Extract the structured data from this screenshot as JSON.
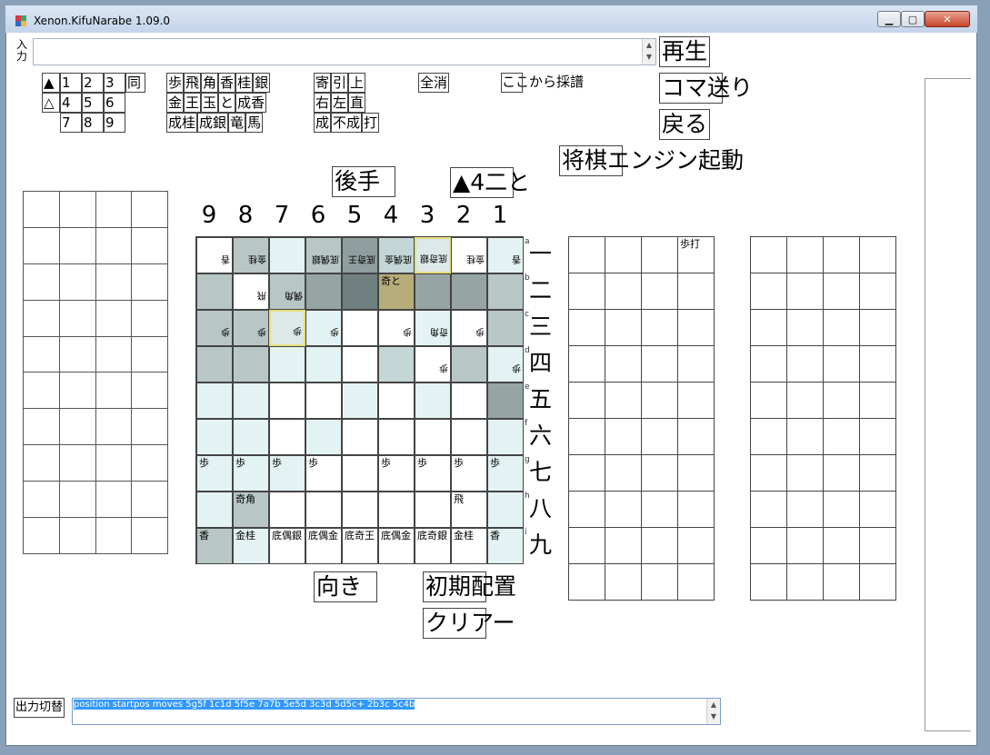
{
  "window": {
    "title": "Xenon.KifuNarabe 1.09.0",
    "minimize_label": "0",
    "maximize_label": "1",
    "close_label": "r"
  },
  "input": {
    "label": "入力",
    "value": ""
  },
  "buttons": {
    "play": "再生",
    "step": "コマ送り",
    "back": "戻る",
    "engine": "将棋エンジン起動",
    "gote": "後手",
    "last_move": "▲4二と",
    "direction": "向き",
    "initial": "初期配置",
    "clear": "クリアー",
    "output_toggle": "出力切替"
  },
  "palette": {
    "turn": [
      [
        "▲",
        "1",
        "2",
        "3",
        "同"
      ],
      [
        "△",
        "4",
        "5",
        "6"
      ],
      [
        "7",
        "8",
        "9"
      ]
    ],
    "pieces": [
      [
        "歩",
        "飛",
        "角",
        "香",
        "桂",
        "銀"
      ],
      [
        "金",
        "王",
        "玉",
        "と",
        "成香"
      ],
      [
        "成桂",
        "成銀",
        "竜",
        "馬"
      ]
    ],
    "modifiers": [
      [
        "寄",
        "引",
        "上"
      ],
      [
        "右",
        "左",
        "直"
      ],
      [
        "成",
        "不成",
        "打"
      ]
    ],
    "clear_all": "全消",
    "record_from_here": "ここから採譜"
  },
  "board": {
    "columns": [
      "9",
      "8",
      "7",
      "6",
      "5",
      "4",
      "3",
      "2",
      "1"
    ],
    "rows": [
      "一",
      "二",
      "三",
      "四",
      "五",
      "六",
      "七",
      "八",
      "九"
    ],
    "row_letters": [
      "a",
      "b",
      "c",
      "d",
      "e",
      "f",
      "g",
      "h",
      "i"
    ],
    "squares": [
      [
        {
          "t": "香",
          "rev": true,
          "bg": "#ffffff"
        },
        {
          "t": "金桂",
          "rev": true,
          "bg": "#b9c6c6"
        },
        {
          "t": "",
          "bg": "#e3f2f2",
          "hl": false
        },
        {
          "t": "底偶銀",
          "rev": true,
          "bg": "#b9c6c6"
        },
        {
          "t": "底奇王",
          "rev": true,
          "bg": "#8f9e9e"
        },
        {
          "t": "底偶金",
          "rev": true,
          "bg": "#c4d6d6"
        },
        {
          "t": "底奇銀",
          "rev": true,
          "bg": "#dde8e8",
          "hl": true
        },
        {
          "t": "金桂",
          "rev": true,
          "bg": "#ffffff"
        },
        {
          "t": "香",
          "rev": true,
          "bg": "#e3f2f2"
        }
      ],
      [
        {
          "t": "",
          "bg": "#b9c6c6"
        },
        {
          "t": "飛",
          "rev": true,
          "bg": "#ffffff"
        },
        {
          "t": "偶角",
          "rev": true,
          "bg": "#b9c6c6"
        },
        {
          "t": "",
          "bg": "#96a4a4"
        },
        {
          "t": "",
          "bg": "#6f7f7f"
        },
        {
          "t": "奇と",
          "bg": "#b7ad7a"
        },
        {
          "t": "",
          "bg": "#96a4a4"
        },
        {
          "t": "",
          "bg": "#96a4a4"
        },
        {
          "t": "",
          "bg": "#b9c6c6"
        }
      ],
      [
        {
          "t": "歩",
          "rev": true,
          "bg": "#b9c6c6"
        },
        {
          "t": "歩",
          "rev": true,
          "bg": "#b9c6c6"
        },
        {
          "t": "歩",
          "rev": true,
          "bg": "#dde8e8",
          "hl": true
        },
        {
          "t": "歩",
          "rev": true,
          "bg": "#e3f2f2"
        },
        {
          "t": "",
          "bg": "#ffffff"
        },
        {
          "t": "歩",
          "rev": true,
          "bg": "#ffffff"
        },
        {
          "t": "奇角",
          "rev": true,
          "bg": "#e3f2f2"
        },
        {
          "t": "歩",
          "rev": true,
          "bg": "#ffffff"
        },
        {
          "t": "",
          "bg": "#b9c6c6"
        }
      ],
      [
        {
          "t": "",
          "bg": "#b9c6c6"
        },
        {
          "t": "",
          "bg": "#b9c6c6"
        },
        {
          "t": "",
          "bg": "#e3f2f2"
        },
        {
          "t": "",
          "bg": "#e3f2f2"
        },
        {
          "t": "",
          "bg": "#ffffff"
        },
        {
          "t": "",
          "bg": "#c4d6d6"
        },
        {
          "t": "歩",
          "rev": true,
          "bg": "#ffffff"
        },
        {
          "t": "",
          "bg": "#b9c6c6"
        },
        {
          "t": "歩",
          "rev": true,
          "bg": "#e3f2f2"
        }
      ],
      [
        {
          "t": "",
          "bg": "#e3f2f2"
        },
        {
          "t": "",
          "bg": "#e3f2f2"
        },
        {
          "t": "",
          "bg": "#ffffff"
        },
        {
          "t": "",
          "bg": "#ffffff"
        },
        {
          "t": "",
          "bg": "#e3f2f2"
        },
        {
          "t": "",
          "bg": "#ffffff"
        },
        {
          "t": "",
          "bg": "#e3f2f2"
        },
        {
          "t": "",
          "bg": "#ffffff"
        },
        {
          "t": "",
          "bg": "#96a4a4"
        }
      ],
      [
        {
          "t": "",
          "bg": "#e3f2f2"
        },
        {
          "t": "",
          "bg": "#e3f2f2"
        },
        {
          "t": "",
          "bg": "#ffffff"
        },
        {
          "t": "",
          "bg": "#e3f2f2"
        },
        {
          "t": "",
          "bg": "#ffffff"
        },
        {
          "t": "",
          "bg": "#ffffff"
        },
        {
          "t": "",
          "bg": "#ffffff"
        },
        {
          "t": "",
          "bg": "#ffffff"
        },
        {
          "t": "",
          "bg": "#e3f2f2"
        }
      ],
      [
        {
          "t": "歩",
          "bg": "#e3f2f2"
        },
        {
          "t": "歩",
          "bg": "#e3f2f2"
        },
        {
          "t": "歩",
          "bg": "#e3f2f2"
        },
        {
          "t": "歩",
          "bg": "#ffffff"
        },
        {
          "t": "",
          "bg": "#ffffff"
        },
        {
          "t": "歩",
          "bg": "#ffffff"
        },
        {
          "t": "歩",
          "bg": "#ffffff"
        },
        {
          "t": "歩",
          "bg": "#ffffff"
        },
        {
          "t": "歩",
          "bg": "#e3f2f2"
        }
      ],
      [
        {
          "t": "",
          "bg": "#e3f2f2"
        },
        {
          "t": "奇角",
          "bg": "#b9c6c6"
        },
        {
          "t": "",
          "bg": "#ffffff"
        },
        {
          "t": "",
          "bg": "#ffffff"
        },
        {
          "t": "",
          "bg": "#ffffff"
        },
        {
          "t": "",
          "bg": "#ffffff"
        },
        {
          "t": "",
          "bg": "#ffffff"
        },
        {
          "t": "飛",
          "bg": "#ffffff"
        },
        {
          "t": "",
          "bg": "#e3f2f2"
        }
      ],
      [
        {
          "t": "香",
          "bg": "#b9c6c6"
        },
        {
          "t": "金桂",
          "bg": "#e3f2f2"
        },
        {
          "t": "底偶銀",
          "bg": "#ffffff"
        },
        {
          "t": "底偶金",
          "bg": "#ffffff"
        },
        {
          "t": "底奇王",
          "bg": "#ffffff"
        },
        {
          "t": "底偶金",
          "bg": "#ffffff"
        },
        {
          "t": "底奇銀",
          "bg": "#ffffff"
        },
        {
          "t": "金桂",
          "bg": "#ffffff"
        },
        {
          "t": "香",
          "bg": "#e3f2f2"
        }
      ]
    ]
  },
  "hand_right": {
    "first_cell": "歩打"
  },
  "output": {
    "value": "position startpos moves 5g5f 1c1d 5f5e 7a7b 5e5d 3c3d 5d5c+ 2b3c 5c4b"
  }
}
